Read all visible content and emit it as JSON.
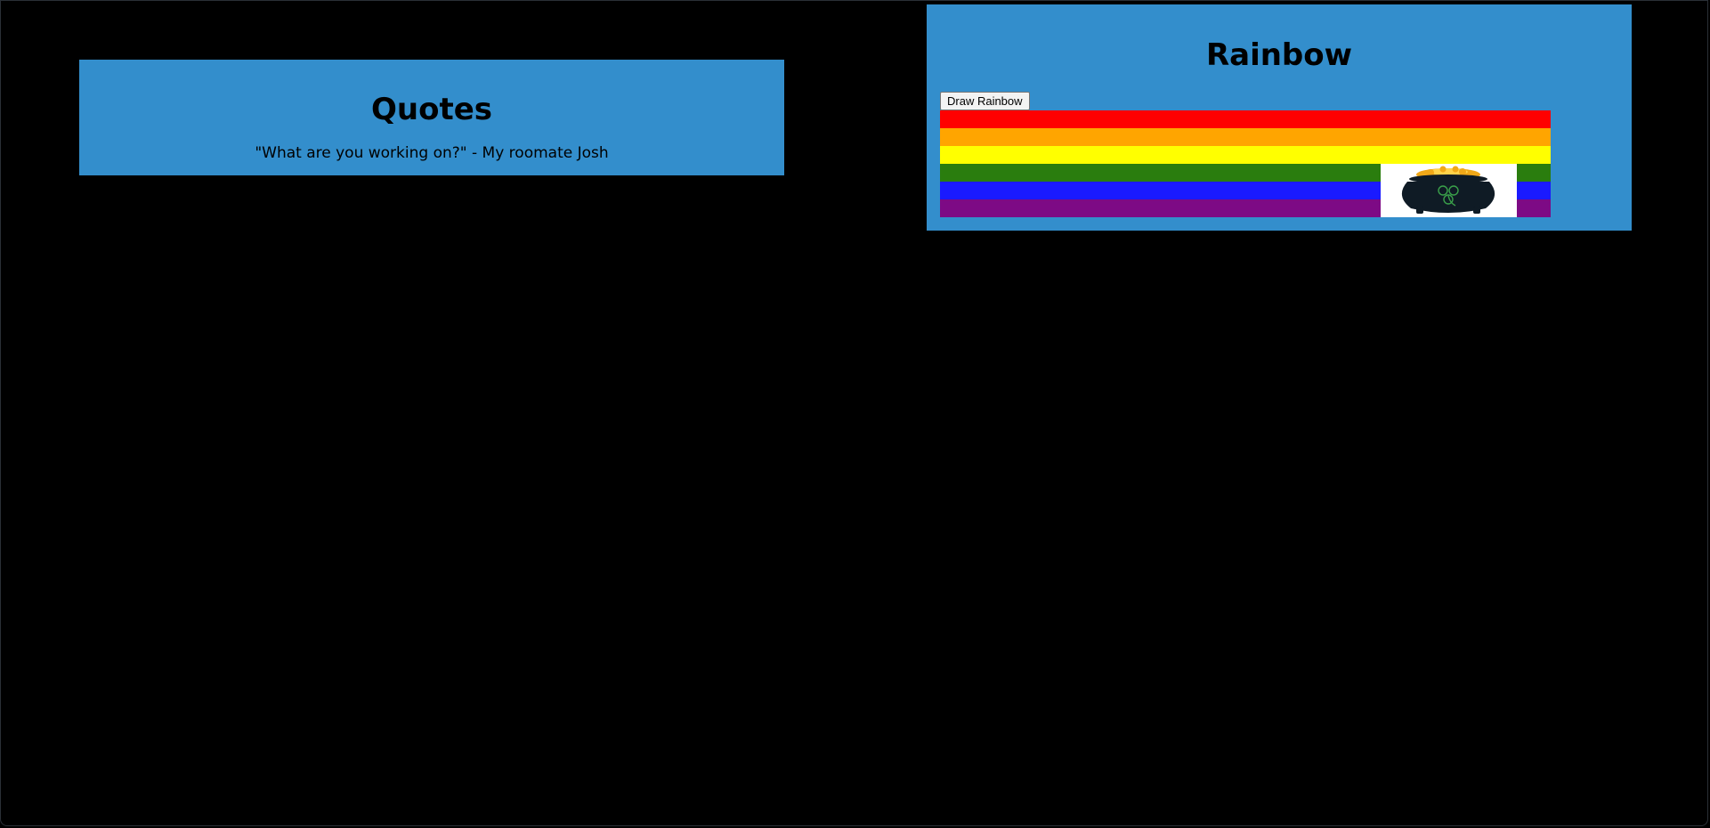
{
  "quotes": {
    "title": "Quotes",
    "quote_text": "\"What are you working on?\" - My roomate Josh"
  },
  "rainbow": {
    "title": "Rainbow",
    "draw_button_label": "Draw Rainbow",
    "stripes": [
      {
        "name": "red",
        "color": "#ff0000"
      },
      {
        "name": "orange",
        "color": "#ffa500"
      },
      {
        "name": "yellow",
        "color": "#ffff00"
      },
      {
        "name": "green",
        "color": "#2a7d0e"
      },
      {
        "name": "blue",
        "color": "#1a1aff"
      },
      {
        "name": "purple",
        "color": "#7d0a85"
      }
    ],
    "pot_image": {
      "icon": "pot-of-gold-icon",
      "pot_color": "#0f1b25",
      "gold_color": "#f0a818",
      "shamrock_color": "#3aa04a"
    }
  },
  "colors": {
    "background": "#000000",
    "panel": "#338ecc"
  }
}
